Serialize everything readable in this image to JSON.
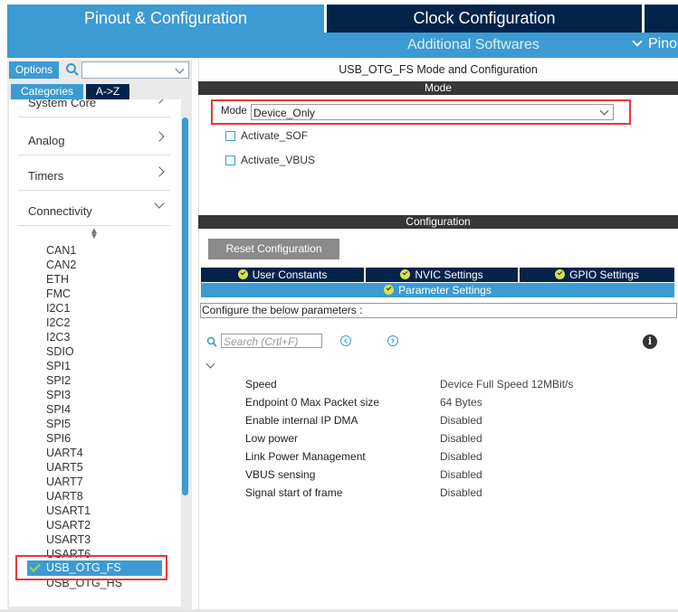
{
  "tabs": {
    "pinout": "Pinout & Configuration",
    "clock": "Clock Configuration",
    "additional": "Additional Softwares",
    "pinout_view": "Pino"
  },
  "left": {
    "options": "Options",
    "search_value": "",
    "categories": "Categories",
    "az": "A->Z",
    "category_items": [
      "System Core",
      "Analog",
      "Timers",
      "Connectivity"
    ],
    "peripherals": [
      "CAN1",
      "CAN2",
      "ETH",
      "FMC",
      "I2C1",
      "I2C2",
      "I2C3",
      "SDIO",
      "SPI1",
      "SPI2",
      "SPI3",
      "SPI4",
      "SPI5",
      "SPI6",
      "UART4",
      "UART5",
      "UART7",
      "UART8",
      "USART1",
      "USART2",
      "USART3",
      "USART6"
    ],
    "selected": "USB_OTG_FS",
    "after_selected": "USB_OTG_HS"
  },
  "mode": {
    "title": "USB_OTG_FS Mode and Configuration",
    "header": "Mode",
    "label": "Mode",
    "value": "Device_Only",
    "checkboxes": [
      "Activate_SOF",
      "Activate_VBUS"
    ]
  },
  "config": {
    "header": "Configuration",
    "reset": "Reset Configuration",
    "tabs": [
      "User Constants",
      "NVIC Settings",
      "GPIO Settings",
      "Parameter Settings"
    ],
    "configure_text": "Configure the below parameters :",
    "search_placeholder": "Search (Crtl+F)",
    "params": [
      {
        "name": "Speed",
        "value": "Device Full Speed 12MBit/s"
      },
      {
        "name": "Endpoint 0 Max Packet size",
        "value": "64 Bytes"
      },
      {
        "name": "Enable internal IP DMA",
        "value": "Disabled"
      },
      {
        "name": "Low power",
        "value": "Disabled"
      },
      {
        "name": "Link Power Management",
        "value": "Disabled"
      },
      {
        "name": "VBUS sensing",
        "value": "Disabled"
      },
      {
        "name": "Signal start of frame",
        "value": "Disabled"
      }
    ]
  },
  "colors": {
    "accent": "#3c9bd2",
    "dark_navy": "#03234b",
    "header_dark": "#373737",
    "highlight_red": "#e53935",
    "check_green": "#9fd63b"
  }
}
